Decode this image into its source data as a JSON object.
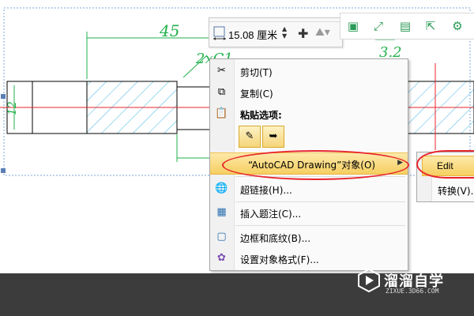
{
  "size_toolbar": {
    "width_value": "15.08 厘米",
    "icons": [
      "shape-width-icon",
      "spin-arrows-icon",
      "crop-icon",
      "text-wrap-icon"
    ]
  },
  "floating_toolbar": {
    "icons": [
      "layout-icon",
      "fullscreen-icon",
      "save-icon",
      "share-icon",
      "settings-icon"
    ]
  },
  "drawing_annotations": {
    "dim_45": "45",
    "dim_chamfer": "2xC1",
    "dim_diameter": "12",
    "dim_right": "3.2"
  },
  "context_menu": {
    "items": [
      {
        "label": "剪切(T)",
        "icon": "scissors-icon"
      },
      {
        "label": "复制(C)",
        "icon": "copy-icon"
      },
      {
        "label": "粘贴选项:",
        "icon": "paste-icon"
      },
      {
        "label": "“AutoCAD Drawing”对象(O)",
        "icon": "none"
      },
      {
        "label": "超链接(H)...",
        "icon": "hyperlink-icon"
      },
      {
        "label": "插入题注(C)...",
        "icon": "caption-icon"
      },
      {
        "label": "边框和底纹(B)...",
        "icon": "border-icon"
      },
      {
        "label": "设置对象格式(F)...",
        "icon": "format-object-icon"
      }
    ]
  },
  "sub_menu": {
    "edit_label": "Edit",
    "convert_label": "转换(V)..."
  },
  "watermark": {
    "title": "溜溜自学",
    "url": "ZIXUE.3D66.COM"
  },
  "colors": {
    "highlight": "#f6cf61",
    "annotation_red": "#e8242c",
    "hatch_cyan": "#3fb6e6",
    "dimension_green": "#22b14c",
    "toolbar_green": "#2a9a55",
    "bottom_bar": "#3c3c3c"
  }
}
